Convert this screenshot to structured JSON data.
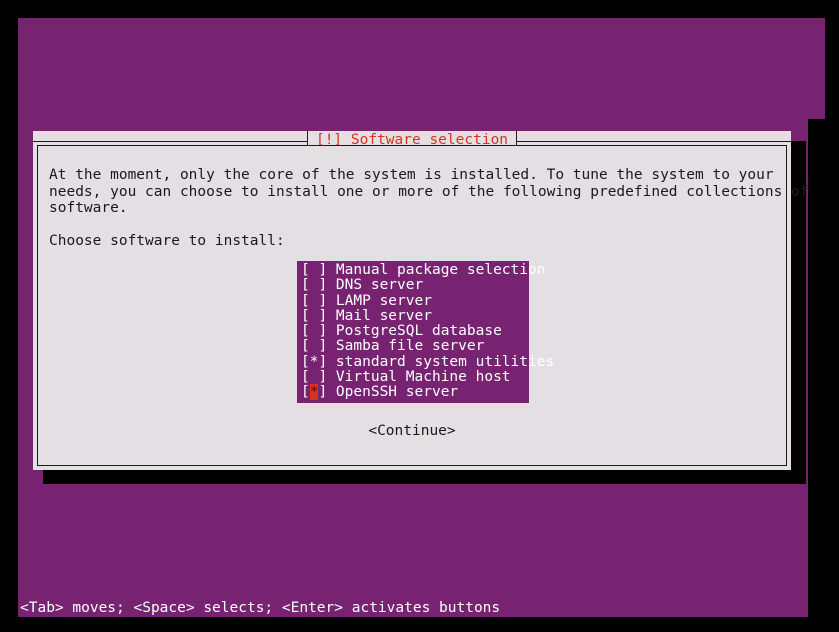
{
  "screen": {
    "background_color": "#000000",
    "console_color": "#772372",
    "dialog_bg_color": "#e3dfe2",
    "text_color": "#1a1a1a",
    "accent_color": "#d8341a"
  },
  "dialog": {
    "title": "[!] Software selection",
    "body_text": "At the moment, only the core of the system is installed. To tune the system to your\nneeds, you can choose to install one or more of the following predefined collections of\nsoftware.",
    "prompt": "Choose software to install:",
    "continue_label": "<Continue>"
  },
  "software_list": {
    "items": [
      {
        "label": "Manual package selection",
        "checked": false,
        "cursor": false
      },
      {
        "label": "DNS server",
        "checked": false,
        "cursor": false
      },
      {
        "label": "LAMP server",
        "checked": false,
        "cursor": false
      },
      {
        "label": "Mail server",
        "checked": false,
        "cursor": false
      },
      {
        "label": "PostgreSQL database",
        "checked": false,
        "cursor": false
      },
      {
        "label": "Samba file server",
        "checked": false,
        "cursor": false
      },
      {
        "label": "standard system utilities",
        "checked": true,
        "cursor": false
      },
      {
        "label": "Virtual Machine host",
        "checked": false,
        "cursor": false
      },
      {
        "label": "OpenSSH server",
        "checked": true,
        "cursor": true
      }
    ],
    "checked_mark": "*",
    "unchecked_mark": " ",
    "bracket_open": "[",
    "bracket_close": "]"
  },
  "statusbar": {
    "text": "<Tab> moves; <Space> selects; <Enter> activates buttons"
  }
}
